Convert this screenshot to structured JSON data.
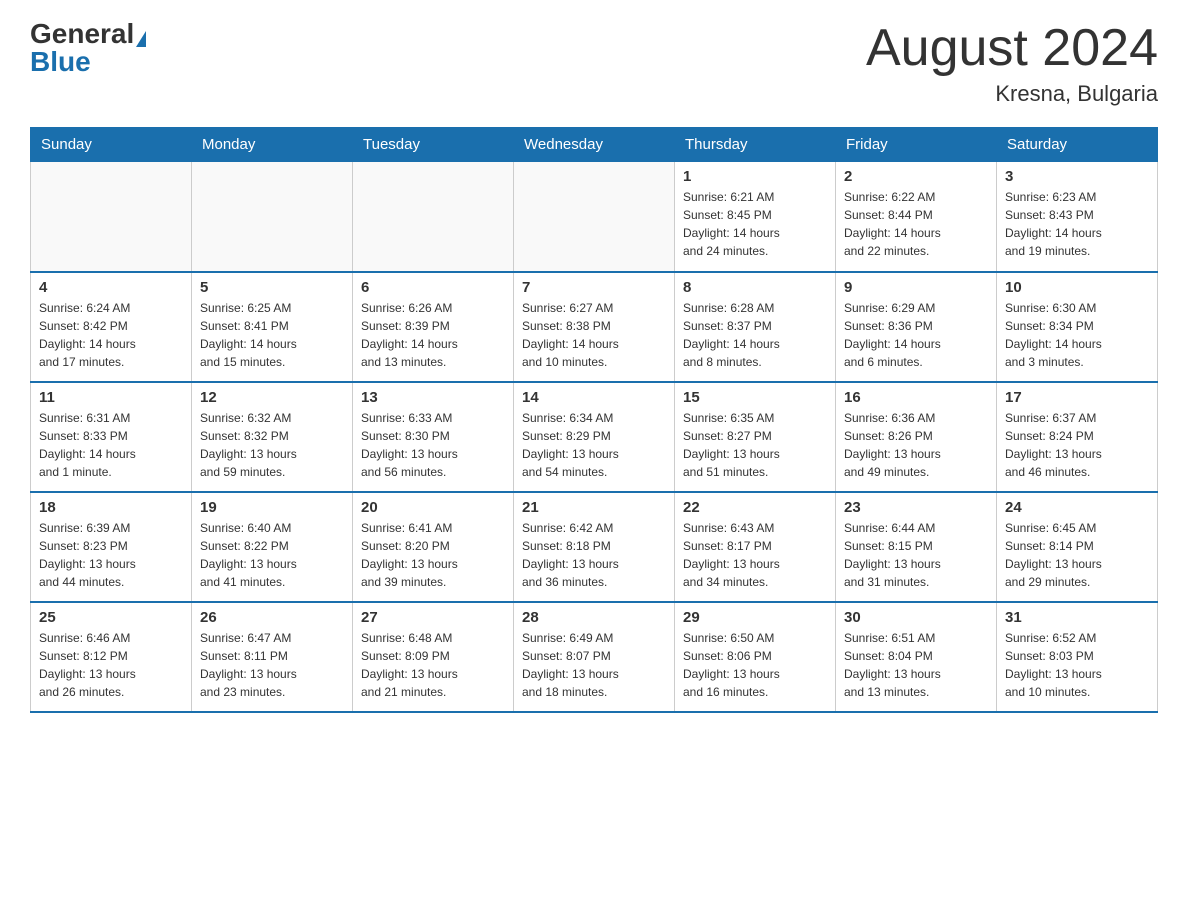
{
  "header": {
    "logo_general": "General",
    "logo_blue": "Blue",
    "month_title": "August 2024",
    "location": "Kresna, Bulgaria"
  },
  "days_of_week": [
    "Sunday",
    "Monday",
    "Tuesday",
    "Wednesday",
    "Thursday",
    "Friday",
    "Saturday"
  ],
  "weeks": [
    {
      "days": [
        {
          "number": "",
          "info": ""
        },
        {
          "number": "",
          "info": ""
        },
        {
          "number": "",
          "info": ""
        },
        {
          "number": "",
          "info": ""
        },
        {
          "number": "1",
          "info": "Sunrise: 6:21 AM\nSunset: 8:45 PM\nDaylight: 14 hours\nand 24 minutes."
        },
        {
          "number": "2",
          "info": "Sunrise: 6:22 AM\nSunset: 8:44 PM\nDaylight: 14 hours\nand 22 minutes."
        },
        {
          "number": "3",
          "info": "Sunrise: 6:23 AM\nSunset: 8:43 PM\nDaylight: 14 hours\nand 19 minutes."
        }
      ]
    },
    {
      "days": [
        {
          "number": "4",
          "info": "Sunrise: 6:24 AM\nSunset: 8:42 PM\nDaylight: 14 hours\nand 17 minutes."
        },
        {
          "number": "5",
          "info": "Sunrise: 6:25 AM\nSunset: 8:41 PM\nDaylight: 14 hours\nand 15 minutes."
        },
        {
          "number": "6",
          "info": "Sunrise: 6:26 AM\nSunset: 8:39 PM\nDaylight: 14 hours\nand 13 minutes."
        },
        {
          "number": "7",
          "info": "Sunrise: 6:27 AM\nSunset: 8:38 PM\nDaylight: 14 hours\nand 10 minutes."
        },
        {
          "number": "8",
          "info": "Sunrise: 6:28 AM\nSunset: 8:37 PM\nDaylight: 14 hours\nand 8 minutes."
        },
        {
          "number": "9",
          "info": "Sunrise: 6:29 AM\nSunset: 8:36 PM\nDaylight: 14 hours\nand 6 minutes."
        },
        {
          "number": "10",
          "info": "Sunrise: 6:30 AM\nSunset: 8:34 PM\nDaylight: 14 hours\nand 3 minutes."
        }
      ]
    },
    {
      "days": [
        {
          "number": "11",
          "info": "Sunrise: 6:31 AM\nSunset: 8:33 PM\nDaylight: 14 hours\nand 1 minute."
        },
        {
          "number": "12",
          "info": "Sunrise: 6:32 AM\nSunset: 8:32 PM\nDaylight: 13 hours\nand 59 minutes."
        },
        {
          "number": "13",
          "info": "Sunrise: 6:33 AM\nSunset: 8:30 PM\nDaylight: 13 hours\nand 56 minutes."
        },
        {
          "number": "14",
          "info": "Sunrise: 6:34 AM\nSunset: 8:29 PM\nDaylight: 13 hours\nand 54 minutes."
        },
        {
          "number": "15",
          "info": "Sunrise: 6:35 AM\nSunset: 8:27 PM\nDaylight: 13 hours\nand 51 minutes."
        },
        {
          "number": "16",
          "info": "Sunrise: 6:36 AM\nSunset: 8:26 PM\nDaylight: 13 hours\nand 49 minutes."
        },
        {
          "number": "17",
          "info": "Sunrise: 6:37 AM\nSunset: 8:24 PM\nDaylight: 13 hours\nand 46 minutes."
        }
      ]
    },
    {
      "days": [
        {
          "number": "18",
          "info": "Sunrise: 6:39 AM\nSunset: 8:23 PM\nDaylight: 13 hours\nand 44 minutes."
        },
        {
          "number": "19",
          "info": "Sunrise: 6:40 AM\nSunset: 8:22 PM\nDaylight: 13 hours\nand 41 minutes."
        },
        {
          "number": "20",
          "info": "Sunrise: 6:41 AM\nSunset: 8:20 PM\nDaylight: 13 hours\nand 39 minutes."
        },
        {
          "number": "21",
          "info": "Sunrise: 6:42 AM\nSunset: 8:18 PM\nDaylight: 13 hours\nand 36 minutes."
        },
        {
          "number": "22",
          "info": "Sunrise: 6:43 AM\nSunset: 8:17 PM\nDaylight: 13 hours\nand 34 minutes."
        },
        {
          "number": "23",
          "info": "Sunrise: 6:44 AM\nSunset: 8:15 PM\nDaylight: 13 hours\nand 31 minutes."
        },
        {
          "number": "24",
          "info": "Sunrise: 6:45 AM\nSunset: 8:14 PM\nDaylight: 13 hours\nand 29 minutes."
        }
      ]
    },
    {
      "days": [
        {
          "number": "25",
          "info": "Sunrise: 6:46 AM\nSunset: 8:12 PM\nDaylight: 13 hours\nand 26 minutes."
        },
        {
          "number": "26",
          "info": "Sunrise: 6:47 AM\nSunset: 8:11 PM\nDaylight: 13 hours\nand 23 minutes."
        },
        {
          "number": "27",
          "info": "Sunrise: 6:48 AM\nSunset: 8:09 PM\nDaylight: 13 hours\nand 21 minutes."
        },
        {
          "number": "28",
          "info": "Sunrise: 6:49 AM\nSunset: 8:07 PM\nDaylight: 13 hours\nand 18 minutes."
        },
        {
          "number": "29",
          "info": "Sunrise: 6:50 AM\nSunset: 8:06 PM\nDaylight: 13 hours\nand 16 minutes."
        },
        {
          "number": "30",
          "info": "Sunrise: 6:51 AM\nSunset: 8:04 PM\nDaylight: 13 hours\nand 13 minutes."
        },
        {
          "number": "31",
          "info": "Sunrise: 6:52 AM\nSunset: 8:03 PM\nDaylight: 13 hours\nand 10 minutes."
        }
      ]
    }
  ]
}
